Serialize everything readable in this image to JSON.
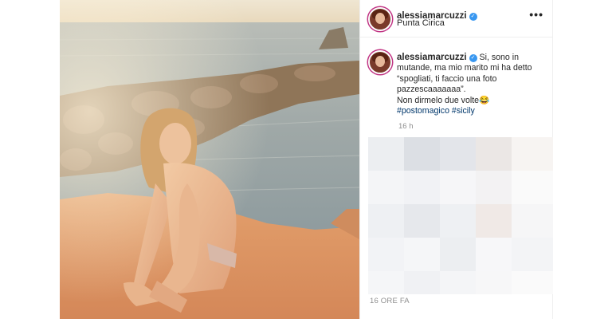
{
  "post": {
    "username": "alessiamarcuzzi",
    "location": "Punta Cirica",
    "more_icon": "more-horizontal-icon",
    "verified_icon": "verified-badge-icon",
    "caption": {
      "line1": "Si, sono in",
      "line2": "mutande, ma mio marito mi ha detto",
      "line3": "“spogliati, ti faccio una foto",
      "line4": "pazzescaaaaaaa”.",
      "line5": "Non dirmelo due volte😂",
      "hashtag1": "#postomagico",
      "hashtag2": "#sicily"
    },
    "caption_time": "16 h",
    "timestamp": "16 ORE FA",
    "accent_color": "#3897f0",
    "hashtag_color": "#00376b"
  }
}
